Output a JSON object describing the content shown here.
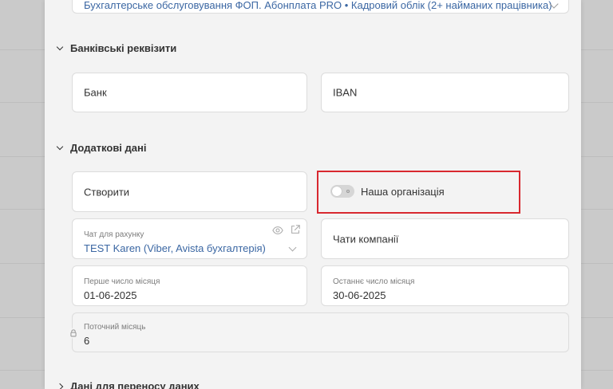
{
  "top_field": {
    "value": "Бухгалтерське обслуговування ФОП. Абонплата PRO • Кадровий облік (2+ найманих працівника)"
  },
  "sections": {
    "bank": {
      "title": "Банківські реквізити"
    },
    "extra": {
      "title": "Додаткові дані"
    },
    "transfer": {
      "title": "Дані для переносу даних"
    }
  },
  "bank_fields": {
    "bank_placeholder": "Банк",
    "iban_placeholder": "IBAN"
  },
  "extra_fields": {
    "create_label": "Створити",
    "our_org": {
      "label": "Наша організація",
      "checked": false
    },
    "invoice_chat": {
      "label": "Чат для рахунку",
      "value": "TEST Karen (Viber, Avista бухгалтерія)"
    },
    "company_chats": {
      "label": "Чати компанії"
    },
    "first_day": {
      "label": "Перше число місяця",
      "value": "01-06-2025"
    },
    "last_day": {
      "label": "Останнє число місяця",
      "value": "30-06-2025"
    },
    "current_month": {
      "label": "Поточний місяць",
      "value": "6"
    }
  },
  "icons": {
    "eye": "eye-icon",
    "external": "external-link-icon",
    "lock": "lock-icon",
    "chevron": "chevron-icon"
  },
  "colors": {
    "link": "#3b67a3",
    "highlight": "#d8282f",
    "toggle_off": "#d6d6d6"
  }
}
